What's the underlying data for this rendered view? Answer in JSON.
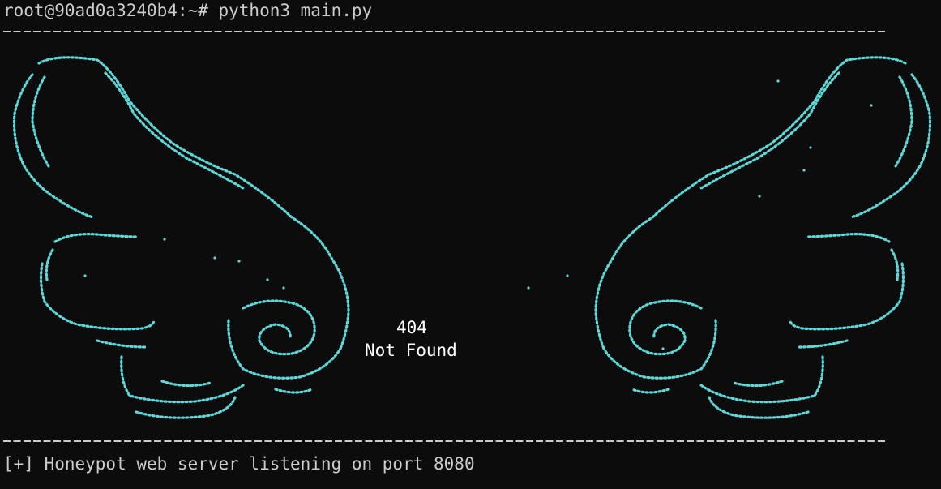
{
  "terminal": {
    "prompt_line": "root@90ad0a3240b4:~# python3 main.py",
    "status_line": "[+] Honeypot web server listening on port 8080"
  },
  "art": {
    "code": "404",
    "message": "Not Found",
    "color": "#5fd7d7",
    "icon": "wings-ascii-art"
  },
  "colors": {
    "background": "#0c0c0c",
    "foreground": "#cccccc",
    "accent": "#5fd7d7"
  }
}
